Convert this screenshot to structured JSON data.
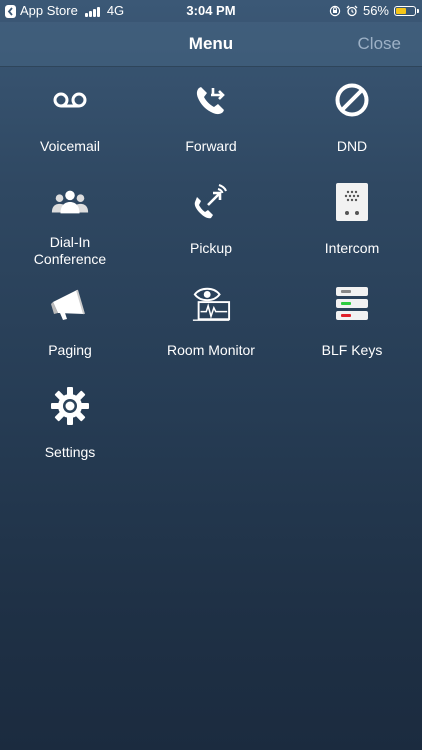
{
  "status_bar": {
    "back_app": "App Store",
    "network": "4G",
    "time": "3:04 PM",
    "battery_percent": "56%",
    "battery_level": 0.56,
    "battery_color": "#f5c518"
  },
  "nav": {
    "title": "Menu",
    "close_label": "Close"
  },
  "menu": {
    "items": [
      {
        "label": "Voicemail",
        "icon": "voicemail-icon"
      },
      {
        "label": "Forward",
        "icon": "call-forward-icon"
      },
      {
        "label": "DND",
        "icon": "do-not-disturb-icon"
      },
      {
        "label_line1": "Dial-In",
        "label_line2": "Conference",
        "icon": "conference-icon"
      },
      {
        "label": "Pickup",
        "icon": "call-pickup-icon"
      },
      {
        "label": "Intercom",
        "icon": "intercom-icon"
      },
      {
        "label": "Paging",
        "icon": "megaphone-icon"
      },
      {
        "label": "Room Monitor",
        "icon": "room-monitor-icon"
      },
      {
        "label": "BLF Keys",
        "icon": "blf-keys-icon"
      },
      {
        "label": "Settings",
        "icon": "gear-icon"
      }
    ]
  }
}
